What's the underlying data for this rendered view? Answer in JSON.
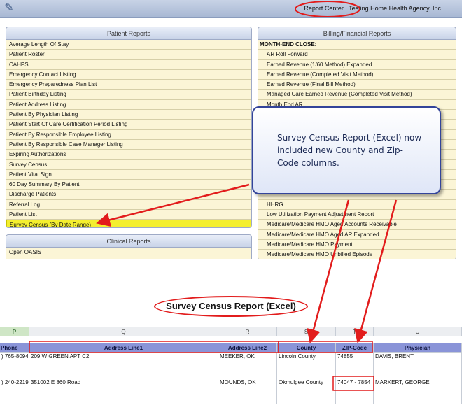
{
  "app": {
    "title": "Report Center | Testing Home Health Agency, Inc",
    "logo_icon": "edit-icon"
  },
  "patient_reports": {
    "header": "Patient Reports",
    "items": [
      "Average Length Of Stay",
      "Patient Roster",
      "CAHPS",
      "Emergency Contact Listing",
      "Emergency  Preparedness Plan List",
      "Patient Birthday Listing",
      "Patient Address Listing",
      "Patient By Physician Listing",
      "Patient Start Of Care Certification Period Listing",
      "Patient By Responsible Employee Listing",
      "Patient By Responsible Case Manager Listing",
      "Expiring Authorizations",
      "Survey Census",
      "Patient Vital Sign",
      "60 Day Summary By Patient",
      "Discharge Patients",
      "Referral Log",
      "Patient List",
      "Survey Census (By Date Range)"
    ],
    "highlighted_index": 18
  },
  "clinical_reports": {
    "header": "Clinical Reports",
    "items": [
      "Open OASIS"
    ]
  },
  "billing_reports": {
    "header": "Billing/Financial Reports",
    "heading": "MONTH-END CLOSE:",
    "items_top": [
      "AR Roll Forward",
      "Earned Revenue (1/60 Method) Expanded",
      "Earned Revenue (Completed Visit Method)",
      "Earned Revenue (Final Bill Method)",
      "Managed Care Earned Revenue (Completed Visit Method)",
      "Month End AR"
    ],
    "items_bottom": [
      "HHRG",
      "Low Utilization Payment Adjustment Report",
      "Medicare/Medicare HMO Aged Accounts Receivable",
      "Medicare/Medicare HMO Aged AR Expanded",
      "Medicare/Medicare HMO Payment",
      "Medicare/Medicare HMO Unbilled Episode"
    ]
  },
  "callout": {
    "text": "Survey Census Report (Excel) now included new County and Zip-Code columns."
  },
  "caption": "Survey Census Report (Excel)",
  "spreadsheet": {
    "column_letters": [
      "P",
      "Q",
      "R",
      "S",
      "T",
      "U"
    ],
    "headers": [
      "Phone",
      "Address Line1",
      "Address Line2",
      "County",
      "ZIP-Code",
      "Physician"
    ],
    "rows": [
      [
        ") 765-8094",
        "209 W GREEN APT C2",
        "MEEKER, OK",
        "Lincoln County",
        "74855",
        "DAVIS, BRENT"
      ],
      [
        ") 240-2219",
        "351002 E 860 Road",
        "MOUNDS, OK",
        "Okmulgee County",
        "74047 - 7854",
        "MARKERT, GEORGE"
      ]
    ]
  },
  "colors": {
    "annotation_red": "#e21c1c",
    "header_blue": "#8a94d8",
    "highlight_yellow": "#f4ef2e",
    "callout_border": "#33449a"
  }
}
